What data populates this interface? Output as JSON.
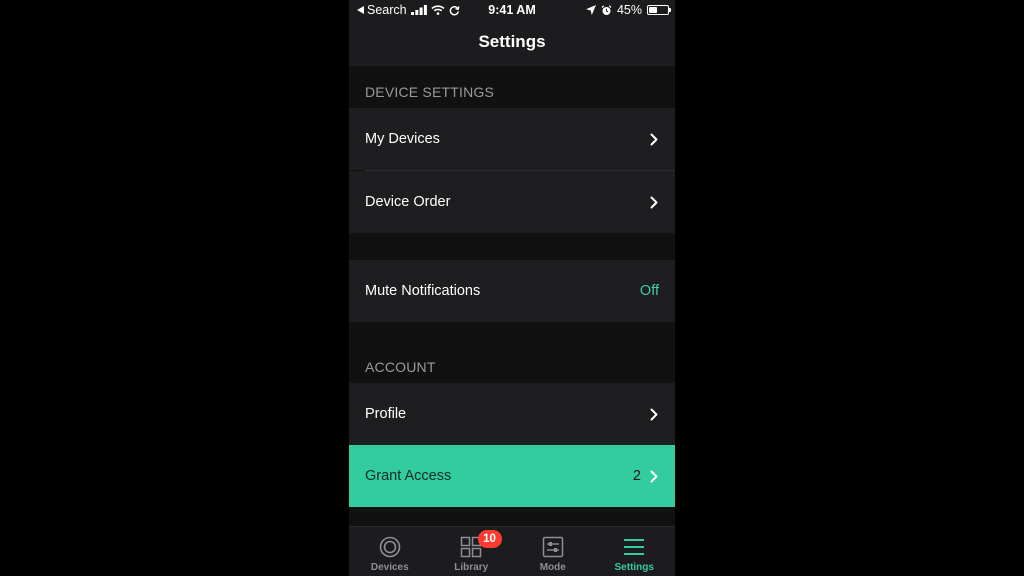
{
  "status_bar": {
    "back_label": "Search",
    "time": "9:41 AM",
    "battery": "45%",
    "battery_level": 0.45
  },
  "nav": {
    "title": "Settings"
  },
  "sections": {
    "device_settings": {
      "header": "DEVICE SETTINGS",
      "items": [
        {
          "label": "My Devices"
        },
        {
          "label": "Device Order"
        }
      ]
    },
    "notifications": {
      "items": [
        {
          "label": "Mute Notifications",
          "value": "Off"
        }
      ]
    },
    "account": {
      "header": "ACCOUNT",
      "items": [
        {
          "label": "Profile"
        },
        {
          "label": "Grant Access",
          "value": "2"
        }
      ]
    }
  },
  "tabs": [
    {
      "label": "Devices",
      "icon": "devices-icon"
    },
    {
      "label": "Library",
      "icon": "library-icon",
      "badge": "10"
    },
    {
      "label": "Mode",
      "icon": "mode-icon"
    },
    {
      "label": "Settings",
      "icon": "settings-menu-icon",
      "active": true
    }
  ],
  "colors": {
    "accent": "#33cc9e",
    "background": "#111112",
    "row": "#1e1e20",
    "badge": "#ff3b30"
  }
}
